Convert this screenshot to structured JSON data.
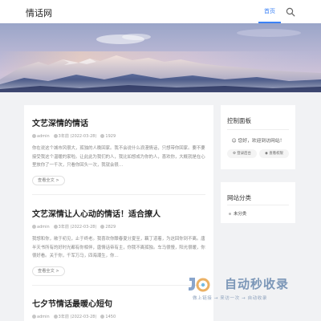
{
  "header": {
    "logo": "情话网",
    "nav_home": "首页",
    "search_icon": "search-icon"
  },
  "articles": [
    {
      "title": "文艺深情的情话",
      "author": "admin",
      "date": "3年前 (2022-03-28)",
      "views": "1929",
      "excerpt": "你在说这个城市风很大，孤独的人晚回家。我不会说什么浪漫情话，只想带你回家。要不要接受我这个温暖的家啦。让此此为我们的人，我比如想成为你的人，喜欢你，大概就是在心里放你了一千次，只看你回头一次，我就会很…",
      "read_more": "查看全文 >"
    },
    {
      "title": "文艺深情让人心动的情话！适合撩人",
      "author": "admin",
      "date": "3年前 (2022-03-28)",
      "views": "2829",
      "excerpt": "我想和你，敞于初见，止于终老。我喜欢你酿春夏分夏至，藕丁道着，为这回你到不离。唐半天书所有的好时光都有你相伴，唐情话帝有主，你我不离孤独。车马很慢，阳光很暖，你很好看。关于你，千军万马，四海潮生，你…",
      "read_more": "查看全文 >"
    },
    {
      "title": "七夕节情话最暖心短句",
      "author": "admin",
      "date": "3年前 (2022-03-28)",
      "views": "1450",
      "excerpt": "",
      "read_more": ""
    }
  ],
  "control_panel": {
    "title": "控制面板",
    "welcome": "您好，欢迎到访网站！",
    "login": "登录后台",
    "register": "查看权限"
  },
  "categories": {
    "title": "网站分类",
    "items": [
      "未分类"
    ]
  },
  "watermark": {
    "main": "自动秒收录",
    "sub": "做上链接 → 来访一次 → 自动收录"
  },
  "colors": {
    "accent": "#3b82f6",
    "page_bg": "#f1f2f4",
    "card_bg": "#ffffff"
  }
}
